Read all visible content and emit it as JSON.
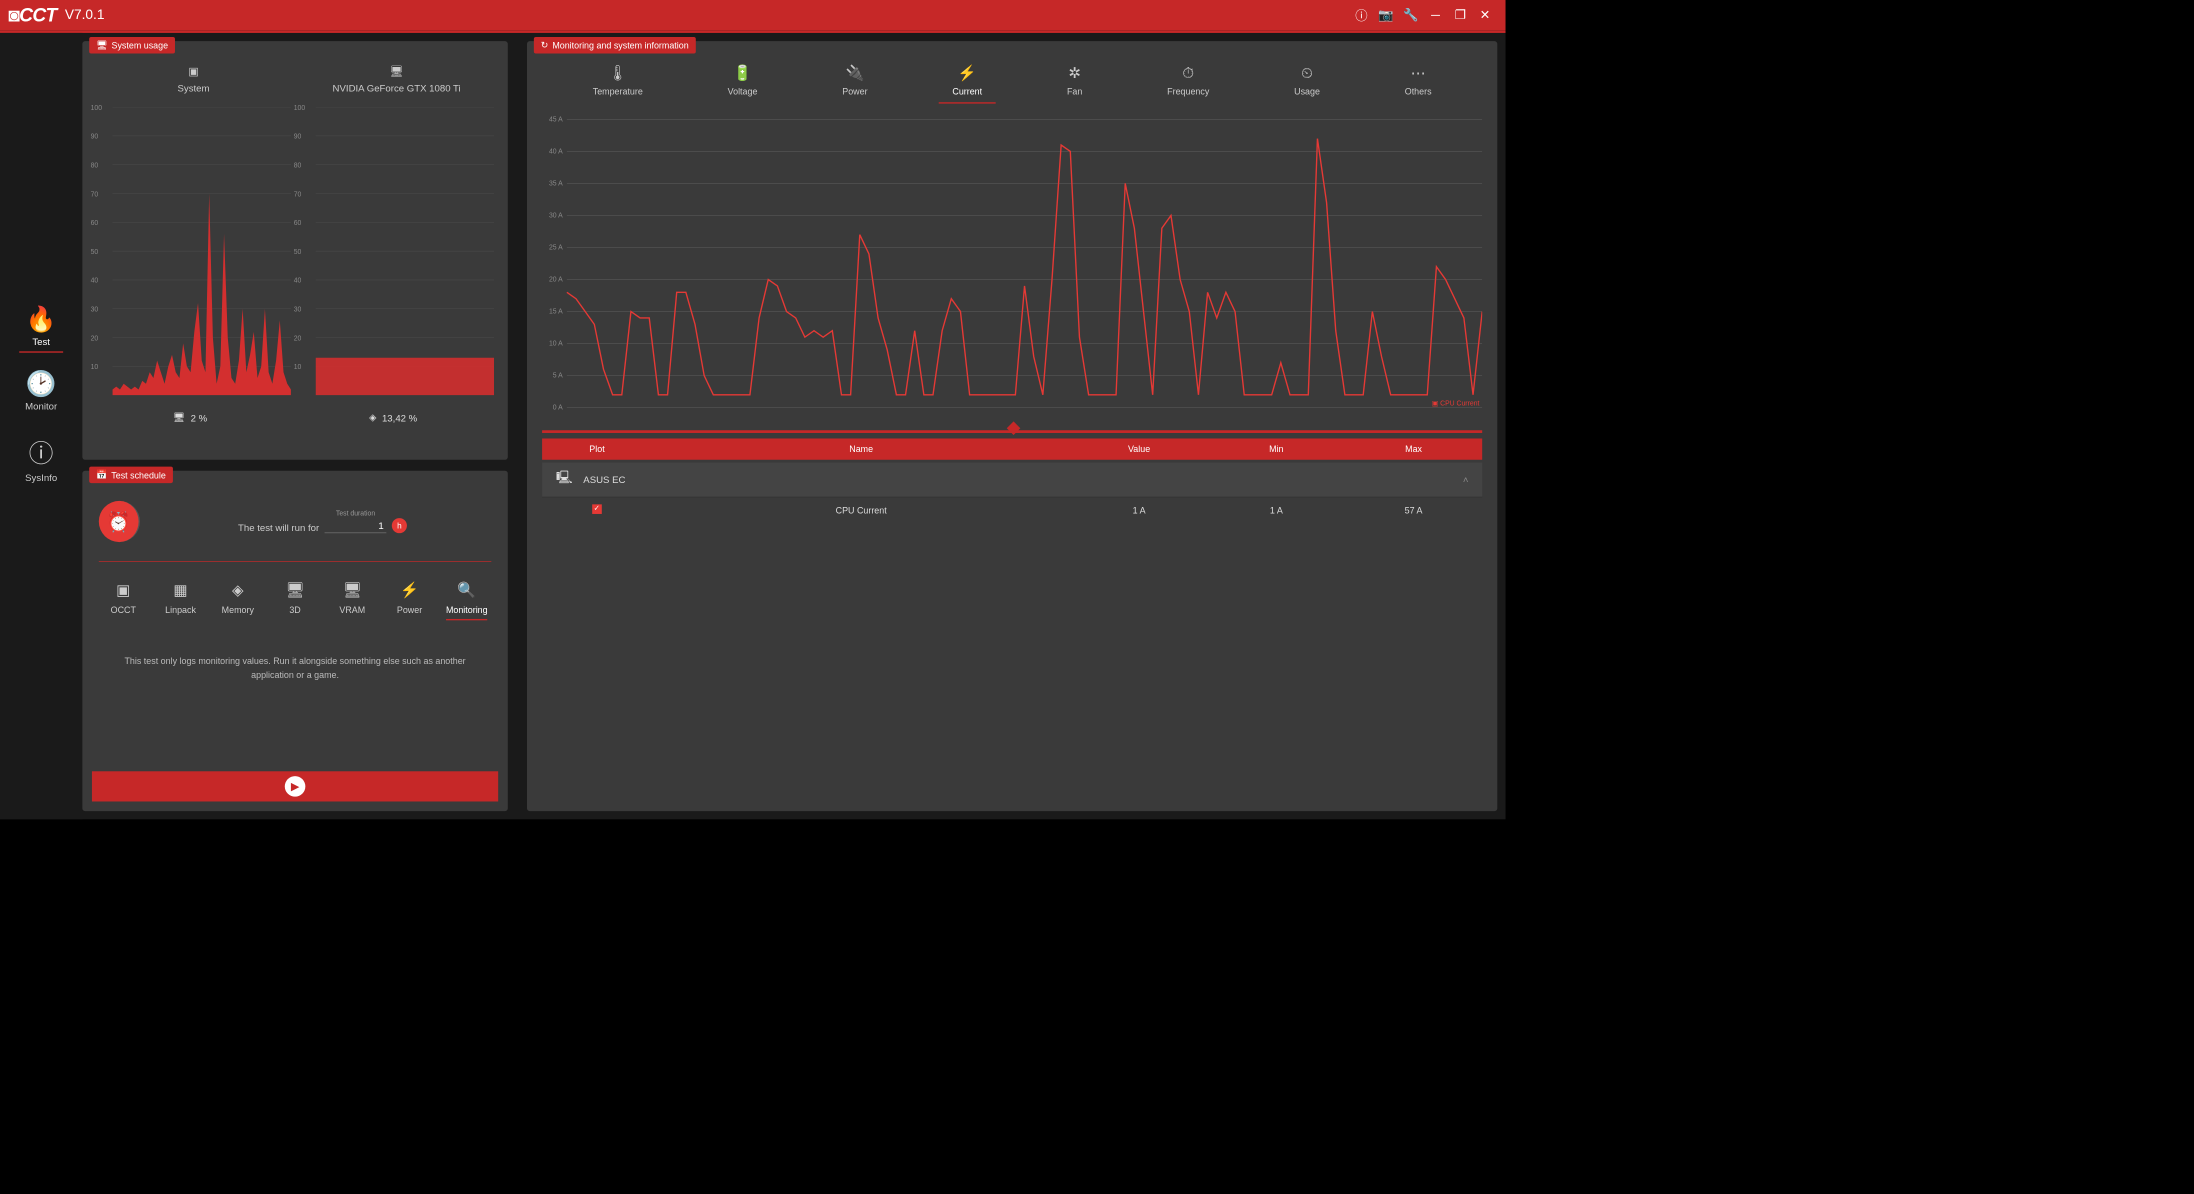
{
  "app": {
    "name": "OCCT",
    "version": "V7.0.1"
  },
  "sidebar": {
    "items": [
      {
        "label": "Test"
      },
      {
        "label": "Monitor"
      },
      {
        "label": "SysInfo"
      }
    ]
  },
  "usage": {
    "title": "System usage",
    "tabs": [
      {
        "label": "System"
      },
      {
        "label": "NVIDIA GeForce GTX 1080 Ti"
      }
    ],
    "footer_cpu": "2 %",
    "footer_mem": "13,42 %"
  },
  "schedule": {
    "title": "Test schedule",
    "run_text": "The test will run for",
    "duration_label": "Test duration",
    "duration_value": "1",
    "unit": "h",
    "types": [
      {
        "label": "OCCT"
      },
      {
        "label": "Linpack"
      },
      {
        "label": "Memory"
      },
      {
        "label": "3D"
      },
      {
        "label": "VRAM"
      },
      {
        "label": "Power"
      },
      {
        "label": "Monitoring"
      }
    ],
    "desc": "This test only logs monitoring values. Run it alongside something else such as another application or a game."
  },
  "monitor": {
    "title": "Monitoring and system information",
    "tabs": [
      {
        "label": "Temperature"
      },
      {
        "label": "Voltage"
      },
      {
        "label": "Power"
      },
      {
        "label": "Current"
      },
      {
        "label": "Fan"
      },
      {
        "label": "Frequency"
      },
      {
        "label": "Usage"
      },
      {
        "label": "Others"
      }
    ],
    "legend": "CPU Current",
    "table": {
      "headers": {
        "plot": "Plot",
        "name": "Name",
        "value": "Value",
        "min": "Min",
        "max": "Max"
      },
      "group": "ASUS EC",
      "row": {
        "name": "CPU Current",
        "value": "1 A",
        "min": "1 A",
        "max": "57 A"
      }
    }
  },
  "chart_data": [
    {
      "type": "line",
      "title": "System usage",
      "ylabel": "%",
      "ylim": [
        0,
        100
      ],
      "yticks": [
        10,
        20,
        30,
        40,
        50,
        60,
        70,
        80,
        90,
        100
      ],
      "values": [
        2,
        3,
        2,
        4,
        3,
        2,
        3,
        2,
        5,
        4,
        8,
        6,
        12,
        8,
        4,
        10,
        14,
        8,
        6,
        18,
        10,
        8,
        22,
        32,
        12,
        8,
        70,
        20,
        4,
        10,
        56,
        20,
        6,
        4,
        12,
        30,
        8,
        14,
        22,
        6,
        10,
        30,
        8,
        4,
        12,
        26,
        8,
        4,
        2
      ]
    },
    {
      "type": "area",
      "title": "GPU usage",
      "ylabel": "%",
      "ylim": [
        0,
        100
      ],
      "yticks": [
        10,
        20,
        30,
        40,
        50,
        60,
        70,
        80,
        90,
        100
      ],
      "values": [
        13,
        13,
        13,
        13,
        13,
        13,
        13,
        13,
        13,
        13,
        13,
        13,
        13,
        13,
        13,
        13,
        13,
        13,
        13,
        13,
        13,
        13,
        13,
        13,
        13,
        13,
        13,
        13,
        13,
        13,
        13,
        13,
        13,
        13,
        13,
        13,
        13,
        13,
        13,
        13,
        13,
        13,
        13,
        13,
        13,
        13,
        13,
        13,
        13
      ]
    },
    {
      "type": "line",
      "title": "CPU Current",
      "ylabel": "A",
      "ylim": [
        0,
        45
      ],
      "yticks": [
        0,
        5,
        10,
        15,
        20,
        25,
        30,
        35,
        40,
        45
      ],
      "values": [
        18,
        17,
        15,
        13,
        6,
        2,
        2,
        15,
        14,
        14,
        2,
        2,
        18,
        18,
        13,
        5,
        2,
        2,
        2,
        2,
        2,
        14,
        20,
        19,
        15,
        14,
        11,
        12,
        11,
        12,
        2,
        2,
        27,
        24,
        14,
        9,
        2,
        2,
        12,
        2,
        2,
        12,
        17,
        15,
        2,
        2,
        2,
        2,
        2,
        2,
        19,
        8,
        2,
        20,
        41,
        40,
        11,
        2,
        2,
        2,
        2,
        35,
        28,
        15,
        2,
        28,
        30,
        20,
        15,
        2,
        18,
        14,
        18,
        15,
        2,
        2,
        2,
        2,
        7,
        2,
        2,
        2,
        42,
        32,
        12,
        2,
        2,
        2,
        15,
        8,
        2,
        2,
        2,
        2,
        2,
        22,
        20,
        17,
        14,
        2,
        15
      ]
    }
  ]
}
